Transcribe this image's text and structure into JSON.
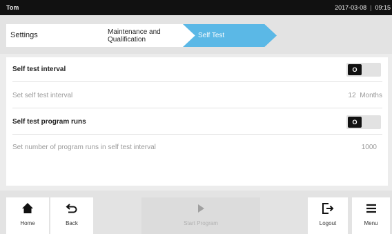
{
  "header": {
    "user": "Tom",
    "date": "2017-03-08",
    "separator": "|",
    "time": "09:15"
  },
  "breadcrumb": [
    {
      "label": "Settings"
    },
    {
      "label": "Maintenance and Qualification"
    },
    {
      "label": "Self Test"
    }
  ],
  "rows": {
    "interval_toggle": {
      "label": "Self test interval",
      "toggle_text": "O"
    },
    "interval_value": {
      "label": "Set self test interval",
      "value": "12",
      "unit": "Months"
    },
    "runs_toggle": {
      "label": "Self test program runs",
      "toggle_text": "O"
    },
    "runs_value": {
      "label": "Set number of program runs in self test interval",
      "value": "1000"
    }
  },
  "toolbar": {
    "home": "Home",
    "back": "Back",
    "start": "Start Program",
    "logout": "Logout",
    "menu": "Menu"
  },
  "colors": {
    "accent": "#5bb8e6",
    "topbar": "#111111",
    "background": "#e3e3e3"
  }
}
